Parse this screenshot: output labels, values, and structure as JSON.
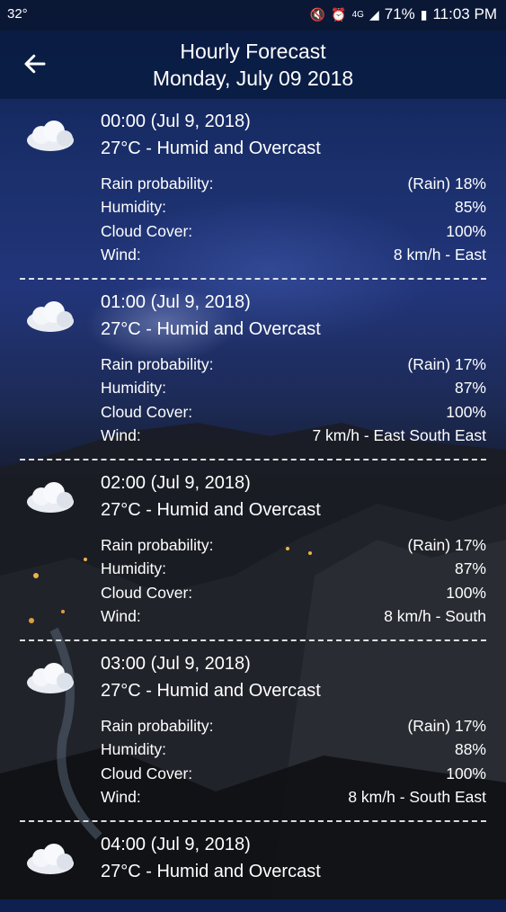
{
  "status_bar": {
    "temperature": "32°",
    "battery": "71%",
    "time": "11:03 PM",
    "network": "4G"
  },
  "header": {
    "title": "Hourly Forecast",
    "subtitle": "Monday, July 09 2018"
  },
  "labels": {
    "rain": "Rain probability:",
    "humidity": "Humidity:",
    "cloud": "Cloud Cover:",
    "wind": "Wind:"
  },
  "entries": [
    {
      "time": "00:00 (Jul 9, 2018)",
      "condition": "27°C - Humid and Overcast",
      "rain": "(Rain) 18%",
      "humidity": "85%",
      "cloud": "100%",
      "wind": "8 km/h - East"
    },
    {
      "time": "01:00 (Jul 9, 2018)",
      "condition": "27°C - Humid and Overcast",
      "rain": "(Rain) 17%",
      "humidity": "87%",
      "cloud": "100%",
      "wind": "7 km/h - East South East"
    },
    {
      "time": "02:00 (Jul 9, 2018)",
      "condition": "27°C - Humid and Overcast",
      "rain": "(Rain) 17%",
      "humidity": "87%",
      "cloud": "100%",
      "wind": "8 km/h - South"
    },
    {
      "time": "03:00 (Jul 9, 2018)",
      "condition": "27°C - Humid and Overcast",
      "rain": "(Rain) 17%",
      "humidity": "88%",
      "cloud": "100%",
      "wind": "8 km/h - South East"
    },
    {
      "time": "04:00 (Jul 9, 2018)",
      "condition": "27°C - Humid and Overcast"
    }
  ],
  "icons": {
    "back": "arrow-left-icon",
    "weather": "cloud-icon"
  },
  "colors": {
    "appbar": "#0a1c42",
    "statusbar": "#0a1836"
  }
}
